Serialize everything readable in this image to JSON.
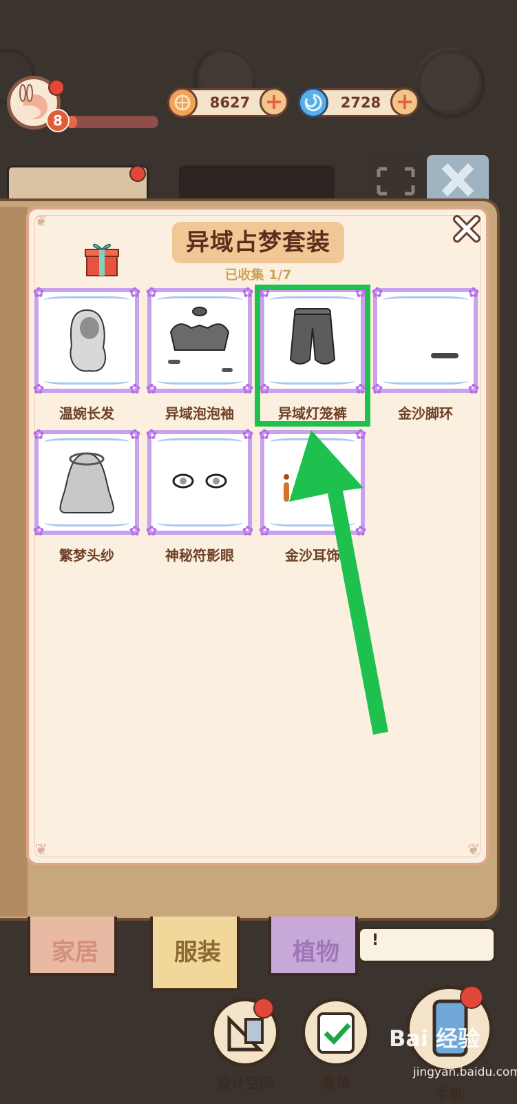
{
  "hud": {
    "level": "8",
    "xp_fraction": 0.12,
    "currencies": [
      {
        "icon": "copper-coin-icon",
        "value": "8627",
        "color": "#f0a35a"
      },
      {
        "icon": "blue-swirl-gem-icon",
        "value": "2728",
        "color": "#5aaee8"
      }
    ]
  },
  "panel": {
    "title": "异域占梦套装",
    "collected": "已收集 1/7",
    "items": [
      {
        "label": "温婉长发",
        "icon": "long-hair-icon"
      },
      {
        "label": "异域泡泡袖",
        "icon": "puff-sleeves-icon"
      },
      {
        "label": "异域灯笼裤",
        "icon": "lantern-pants-icon"
      },
      {
        "label": "金沙脚环",
        "icon": "anklet-icon"
      },
      {
        "label": "繁梦头纱",
        "icon": "veil-icon"
      },
      {
        "label": "神秘符影眼",
        "icon": "mystic-eyes-icon"
      },
      {
        "label": "金沙耳饰",
        "icon": "earring-icon"
      }
    ]
  },
  "bottom_tabs": [
    {
      "label": "家居",
      "color": "#e8b9a3"
    },
    {
      "label": "服装",
      "color": "#f2d79a"
    },
    {
      "label": "植物",
      "color": "#c7a8d8"
    }
  ],
  "speech_text": "!",
  "bottom_buttons": [
    {
      "label": "设计空间"
    },
    {
      "label": "清单"
    },
    {
      "label": "手机"
    }
  ],
  "watermark": {
    "brand": "Bai 经验",
    "url": "jingyan.baidu.com"
  },
  "colors": {
    "highlight": "#1fc14e",
    "arrow": "#1fc14e",
    "card_border": "#c9a2ee"
  }
}
